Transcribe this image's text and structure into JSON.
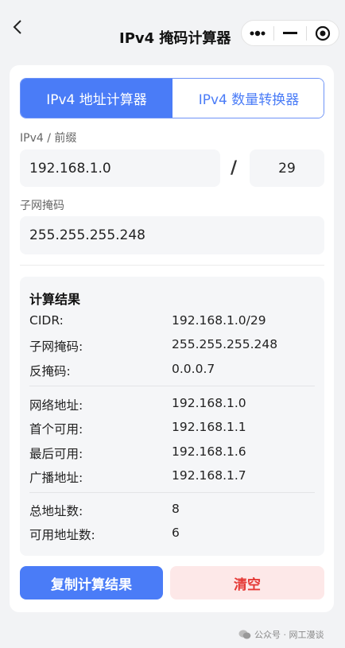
{
  "nav": {
    "title": "IPv4 掩码计算器",
    "icons": [
      "back-chevron-icon",
      "more-dots-icon",
      "minimize-icon",
      "close-target-icon"
    ]
  },
  "tabs": [
    {
      "label": "IPv4 地址计算器",
      "active": true
    },
    {
      "label": "IPv4 数量转换器",
      "active": false
    }
  ],
  "form": {
    "ip_label": "IPv4 / 前缀",
    "ip_value": "192.168.1.0",
    "slash": "/",
    "prefix_value": "29",
    "mask_label": "子网掩码",
    "mask_value": "255.255.255.248"
  },
  "results": {
    "title": "计算结果",
    "rows": [
      {
        "k": "CIDR:",
        "v": "192.168.1.0/29"
      },
      {
        "k": "子网掩码:",
        "v": "255.255.255.248"
      },
      {
        "k": "反掩码:",
        "v": "0.0.0.7"
      },
      {
        "k": "网络地址:",
        "v": "192.168.1.0"
      },
      {
        "k": "首个可用:",
        "v": "192.168.1.1"
      },
      {
        "k": "最后可用:",
        "v": "192.168.1.6"
      },
      {
        "k": "广播地址:",
        "v": "192.168.1.7"
      },
      {
        "k": "总地址数:",
        "v": "8"
      },
      {
        "k": "可用地址数:",
        "v": "6"
      }
    ]
  },
  "buttons": {
    "copy_label": "复制计算结果",
    "clear_label": "清空"
  },
  "watermark": {
    "text": "公众号 · 网工漫谈"
  },
  "colors": {
    "accent": "#4a7cf7",
    "danger": "#e53935",
    "danger_bg": "#fde8e8"
  }
}
